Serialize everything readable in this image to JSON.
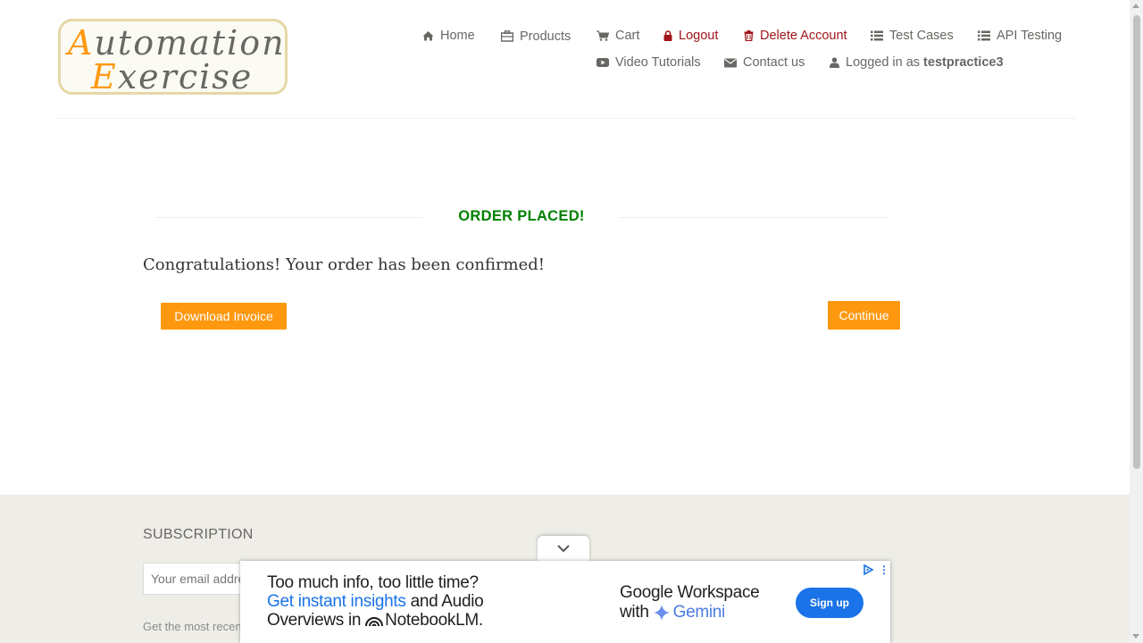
{
  "logo": {
    "line1_cap": "A",
    "line1_rest": "utomation",
    "line2_cap": "E",
    "line2_rest": "xercise"
  },
  "nav": {
    "row1": [
      {
        "label": "Home",
        "icon": "home-icon"
      },
      {
        "label": "Products",
        "icon": "briefcase-icon"
      },
      {
        "label": "Cart",
        "icon": "cart-icon"
      },
      {
        "label": "Logout",
        "icon": "lock-icon"
      },
      {
        "label": "Delete Account",
        "icon": "trash-icon"
      },
      {
        "label": "Test Cases",
        "icon": "list-icon"
      },
      {
        "label": "API Testing",
        "icon": "list-icon"
      }
    ],
    "row2": [
      {
        "label": "Video Tutorials",
        "icon": "youtube-play-icon"
      },
      {
        "label": "Contact us",
        "icon": "envelope-icon"
      },
      {
        "label": "Logged in as",
        "icon": "user-icon",
        "username": "testpractice3"
      }
    ]
  },
  "colors": {
    "accent": "#FE980F",
    "success": "#008000",
    "danger": "#A1161B",
    "footer_bg": "#EEEDE7",
    "ad_blue": "#1A73E8"
  },
  "main": {
    "title": "ORDER PLACED!",
    "message": "Congratulations! Your order has been confirmed!",
    "download_label": "Download Invoice",
    "continue_label": "Continue"
  },
  "footer": {
    "subscription_title": "SUBSCRIPTION",
    "email_placeholder": "Your email address",
    "subscription_text": "Get the most recent updates from our site and be updated your self..."
  },
  "ad": {
    "line1": "Too much info, too little time?",
    "line2_highlight": "Get instant insights",
    "line2_rest": " and Audio",
    "line3_text": "Overviews in",
    "line3_product": "NotebookLM.",
    "brand_line1": "Google Workspace",
    "brand_line2": "with",
    "brand_gemini": "Gemini",
    "cta": "Sign up"
  }
}
